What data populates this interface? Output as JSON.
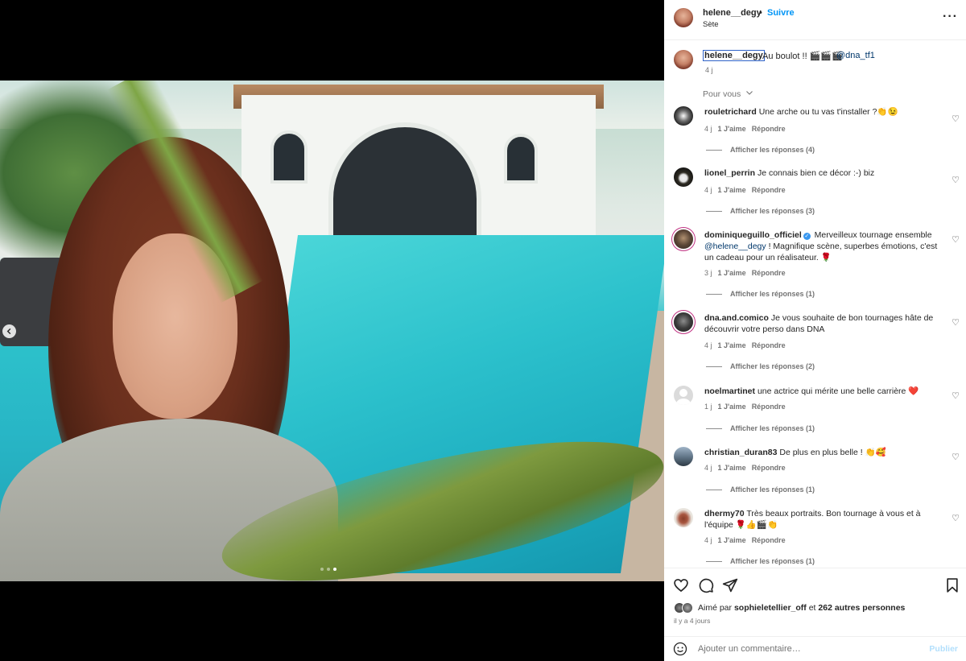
{
  "header": {
    "username": "helene__degy",
    "separator": "•",
    "follow_label": "Suivre",
    "location": "Sète",
    "more_icon": "more-horizontal-icon"
  },
  "caption": {
    "username": "helene__degy",
    "text": "Au boulot !! 🎬🎬🎬",
    "mention": "@dna_tf1",
    "time": "4 j"
  },
  "sort_label": "Pour vous",
  "comments": [
    {
      "username": "rouletrichard",
      "text": "Une arche ou tu vas t'installer ?👏😉",
      "time": "4 j",
      "likes": "1 J'aime",
      "reply": "Répondre",
      "replies": "Afficher les réponses (4)"
    },
    {
      "username": "lionel_perrin",
      "text": "Je connais bien ce décor :-) biz",
      "time": "4 j",
      "likes": "1 J'aime",
      "reply": "Répondre",
      "replies": "Afficher les réponses (3)"
    },
    {
      "username": "dominiqueguillo_officiel",
      "verified": true,
      "text_a": "Merveilleux tournage ensemble",
      "mention": "@helene__degy",
      "text_b": "! Magnifique scène, superbes émotions, c'est un cadeau pour un réalisateur. 🌹",
      "time": "3 j",
      "likes": "1 J'aime",
      "reply": "Répondre",
      "replies": "Afficher les réponses (1)"
    },
    {
      "username": "dna.and.comico",
      "text": "Je vous souhaite de bon tournages hâte de découvrir votre perso dans DNA",
      "time": "4 j",
      "likes": "1 J'aime",
      "reply": "Répondre",
      "replies": "Afficher les réponses (2)"
    },
    {
      "username": "noelmartinet",
      "text": "une actrice qui mérite une belle carrière ❤️",
      "time": "1 j",
      "likes": "1 J'aime",
      "reply": "Répondre",
      "replies": "Afficher les réponses (1)"
    },
    {
      "username": "christian_duran83",
      "text": "De plus en plus belle ! 👏🥰",
      "time": "4 j",
      "likes": "1 J'aime",
      "reply": "Répondre",
      "replies": "Afficher les réponses (1)"
    },
    {
      "username": "dhermy70",
      "text": "Très beaux portraits. Bon tournage à vous et à l'équipe 🌹👍🎬👏",
      "time": "4 j",
      "likes": "1 J'aime",
      "reply": "Répondre",
      "replies": "Afficher les réponses (1)"
    }
  ],
  "likes": {
    "prefix": "Aimé par",
    "user": "sophieletellier_off",
    "conj": "et",
    "others": "262 autres personnes"
  },
  "posted": "il y a 4 jours",
  "add_comment": {
    "placeholder": "Ajouter un commentaire…",
    "publish_label": "Publier"
  },
  "icons": {
    "like": "heart-icon",
    "comment": "comment-icon",
    "share": "paper-plane-icon",
    "save": "bookmark-icon",
    "emoji": "smiley-icon",
    "prev": "chevron-left-icon"
  },
  "carousel": {
    "slides": 3,
    "active": 3
  },
  "colors": {
    "accent": "#0095f6",
    "mention": "#00376b",
    "muted": "#737373"
  }
}
